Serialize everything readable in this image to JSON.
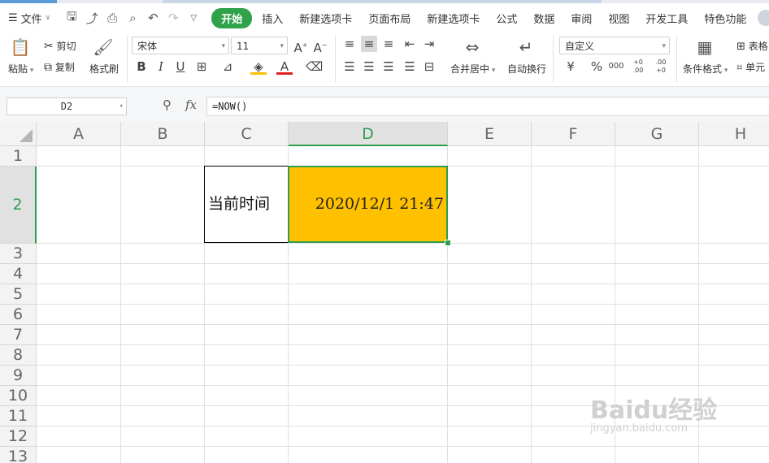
{
  "menu": {
    "file_label": "文件",
    "tabs": [
      "开始",
      "插入",
      "新建选项卡",
      "页面布局",
      "新建选项卡",
      "公式",
      "数据",
      "审阅",
      "视图",
      "开发工具",
      "特色功能"
    ],
    "active_tab": "开始"
  },
  "ribbon": {
    "paste": "粘贴",
    "cut": "剪切",
    "copy": "复制",
    "format_painter": "格式刷",
    "font_name": "宋体",
    "font_size": "11",
    "merge_center": "合并居中",
    "wrap_text": "自动换行",
    "number_format": "自定义",
    "conditional_format": "条件格式",
    "table_style": "表格",
    "single_cell": "单元",
    "currency": "¥",
    "percent": "%",
    "thousands": "000",
    "inc_decimal": "+0 .00",
    "dec_decimal": ".00 +0"
  },
  "formula_bar": {
    "name_box": "D2",
    "fx": "fx",
    "formula": "=NOW()"
  },
  "sheet": {
    "columns": [
      "A",
      "B",
      "C",
      "D",
      "E",
      "F",
      "G",
      "H"
    ],
    "selected_column": "D",
    "rows": [
      "1",
      "2",
      "3",
      "4",
      "5",
      "6",
      "7",
      "8",
      "9",
      "10",
      "11",
      "12",
      "13"
    ],
    "selected_row": "2",
    "cells": {
      "C2": "当前时间",
      "D2": "2020/12/1  21:47"
    },
    "fill_color_d2": "#ffc000",
    "selection_color": "#2e9e4c"
  },
  "watermark": {
    "main": "Baidu经验",
    "sub": "jingyan.baidu.com"
  }
}
